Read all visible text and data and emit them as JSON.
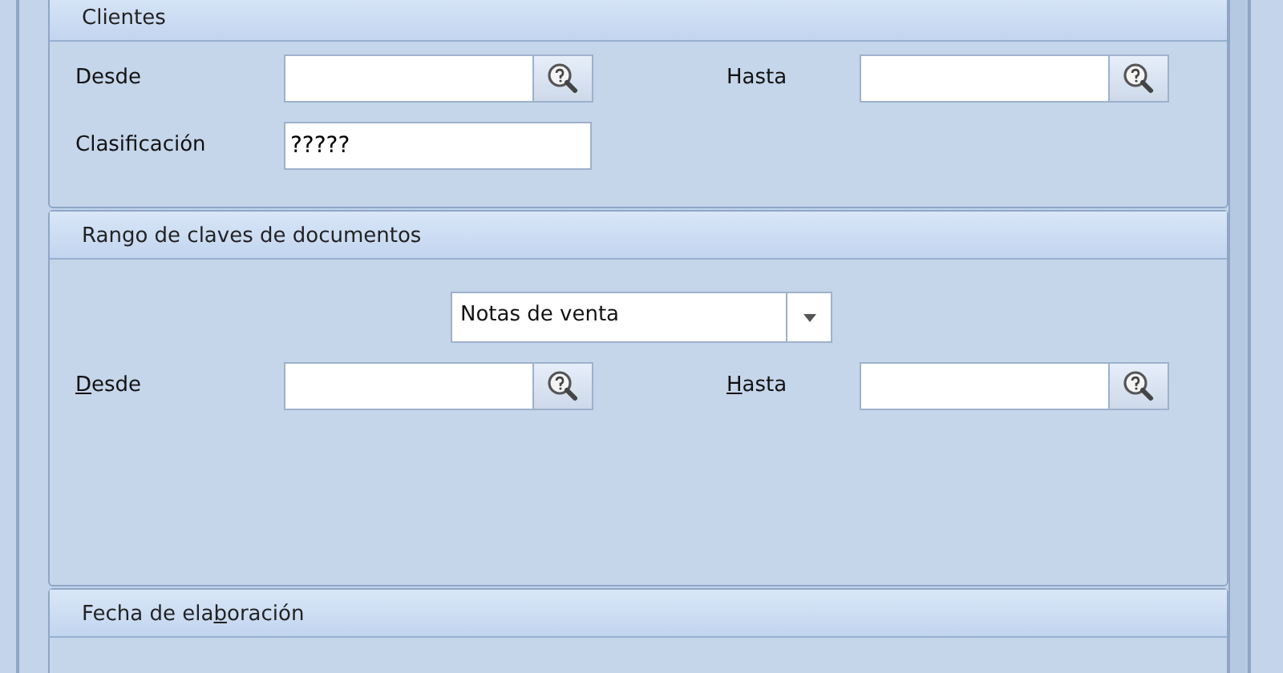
{
  "groups": [
    {
      "title": "Clientes",
      "rows": [
        {
          "kind": "lookups",
          "fields": [
            {
              "label": "Desde"
            },
            {
              "label": "Hasta"
            }
          ]
        },
        {
          "kind": "text",
          "fields": [
            {
              "label": "Clasificación",
              "value": "?????"
            }
          ]
        }
      ]
    },
    {
      "title": "Rango de claves de documentos",
      "rows": [
        {
          "kind": "combo",
          "value": "Notas de venta"
        },
        {
          "kind": "lookups",
          "fields": [
            {
              "label_key": "D",
              "label_after": "esde"
            },
            {
              "label_key": "H",
              "label_after": "asta"
            }
          ]
        }
      ]
    },
    {
      "title": "Fecha de ela",
      "title_key": "b",
      "title_after": "oración"
    }
  ]
}
